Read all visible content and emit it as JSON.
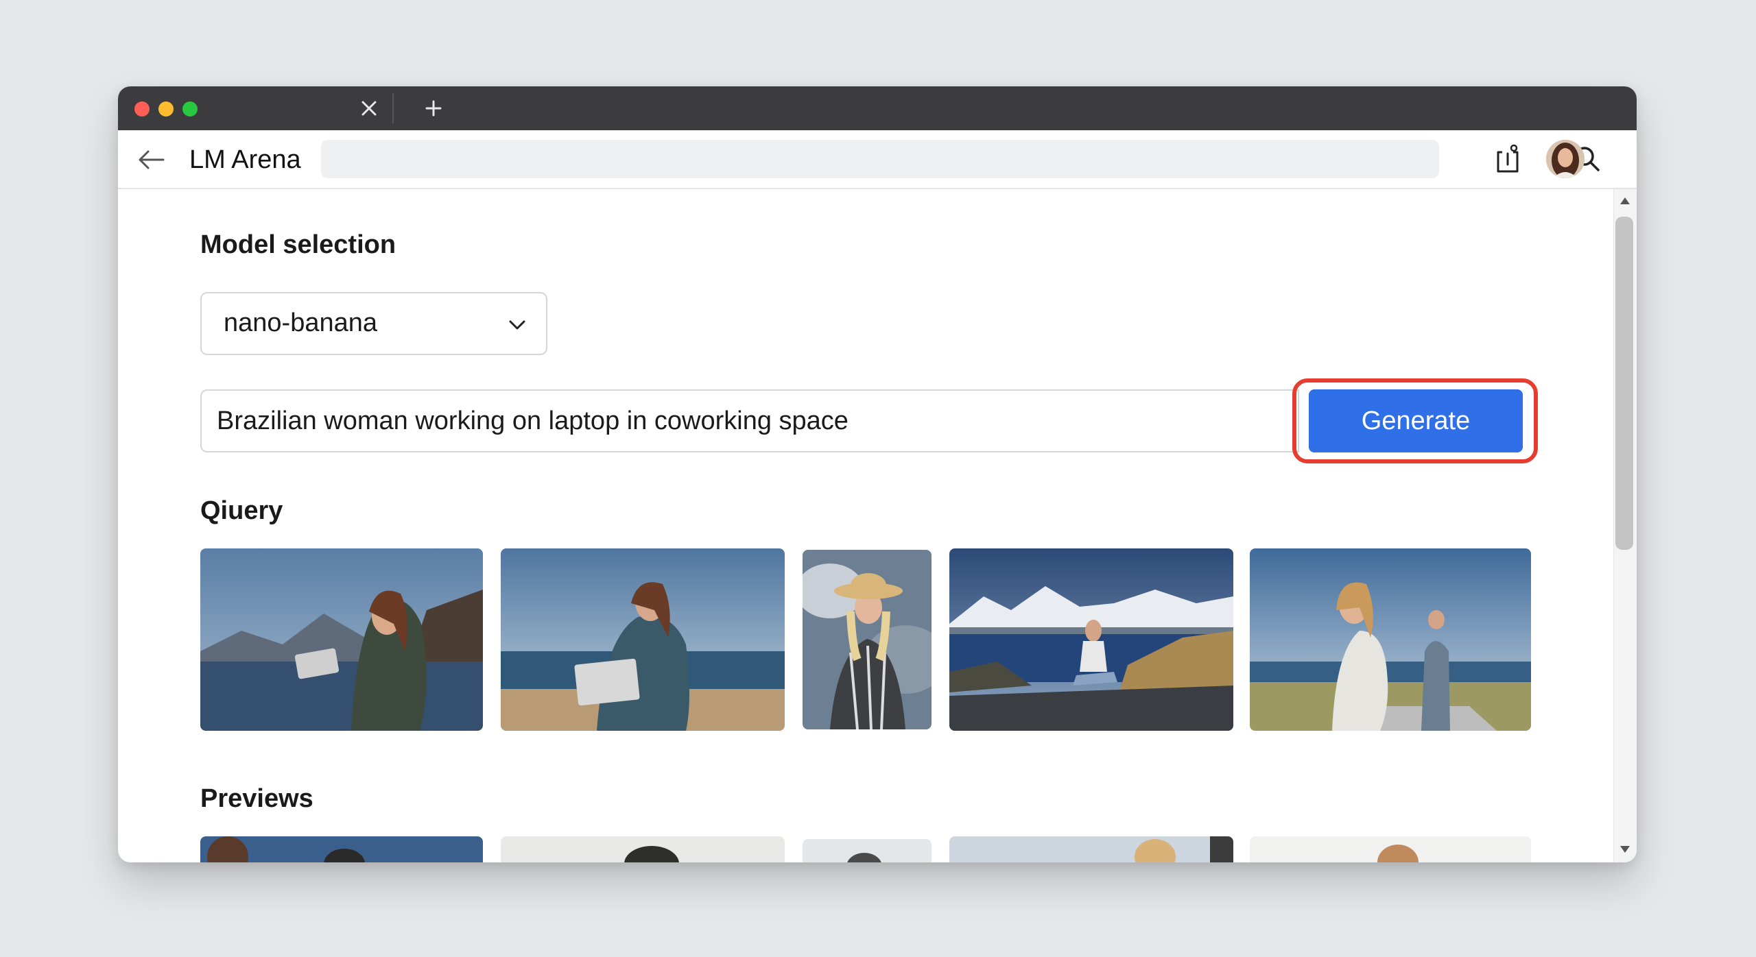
{
  "window": {
    "tab_close_icon": "close-icon",
    "new_tab_icon": "plus-icon"
  },
  "toolbar": {
    "back_icon": "arrow-left-icon",
    "title": "LM Arena",
    "address_value": "",
    "search_icon": "search-icon",
    "share_icon": "share-icon",
    "avatar_icon": "user-avatar",
    "menu_icon": "hamburger-menu-icon"
  },
  "model_selection": {
    "heading": "Model selection",
    "selected": "nano-banana",
    "chevron_icon": "chevron-down-icon"
  },
  "prompt": {
    "value": "Brazilian woman working on laptop in coworking space",
    "button_label": "Generate",
    "highlight_color": "#e53d30",
    "button_color": "#2f6fe7"
  },
  "query": {
    "heading": "Qiuery",
    "images": [
      "woman with tablet by mountain lake",
      "woman with laptop on beach",
      "woman in straw hat",
      "woman sitting by mountain lake",
      "woman on beach path with man"
    ]
  },
  "previews": {
    "heading": "Previews"
  }
}
